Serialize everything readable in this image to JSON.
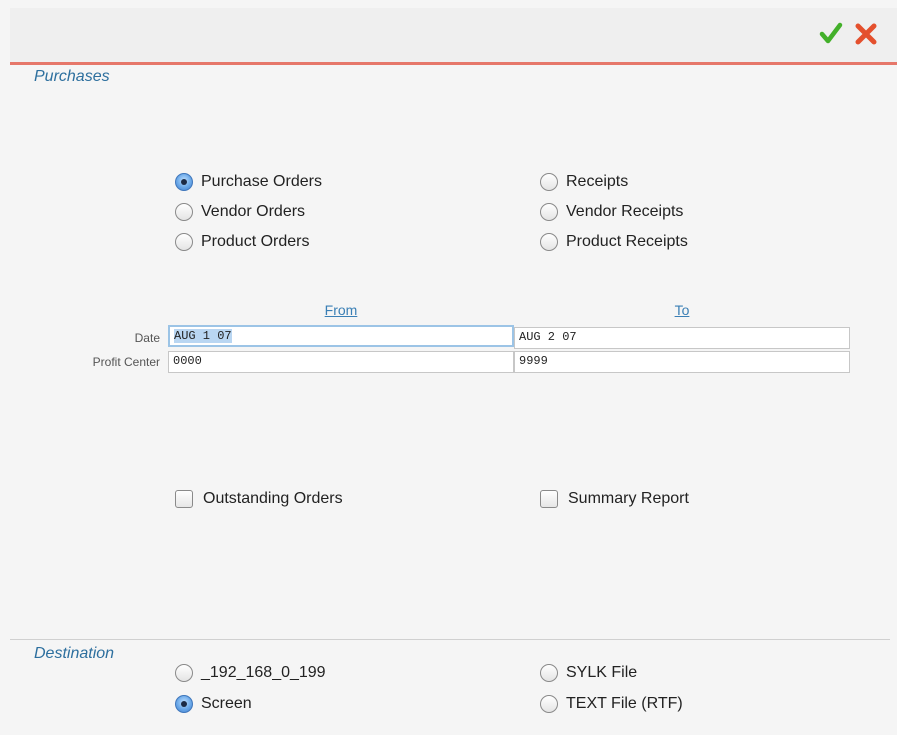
{
  "toolbar": {
    "ok_icon": "checkmark-icon",
    "cancel_icon": "x-icon",
    "ok_color": "#43b02a",
    "cancel_color": "#e4502d"
  },
  "purchases": {
    "section_label": "Purchases",
    "options": [
      {
        "label": "Purchase Orders",
        "selected": true
      },
      {
        "label": "Vendor Orders",
        "selected": false
      },
      {
        "label": "Product Orders",
        "selected": false
      },
      {
        "label": "Receipts",
        "selected": false
      },
      {
        "label": "Vendor Receipts",
        "selected": false
      },
      {
        "label": "Product Receipts",
        "selected": false
      }
    ]
  },
  "range": {
    "from_header": "From",
    "to_header": "To",
    "date_label": "Date",
    "date_from": "AUG 1 07",
    "date_to": "AUG 2 07",
    "profit_center_label": "Profit Center",
    "profit_from": "0000",
    "profit_to": "9999"
  },
  "options": {
    "outstanding_orders": {
      "label": "Outstanding Orders",
      "checked": false
    },
    "summary_report": {
      "label": "Summary Report",
      "checked": false
    }
  },
  "destination": {
    "section_label": "Destination",
    "options": [
      {
        "label": "_192_168_0_199",
        "selected": false
      },
      {
        "label": "Screen",
        "selected": true
      },
      {
        "label": "SYLK File",
        "selected": false
      },
      {
        "label": "TEXT File (RTF)",
        "selected": false
      }
    ]
  }
}
